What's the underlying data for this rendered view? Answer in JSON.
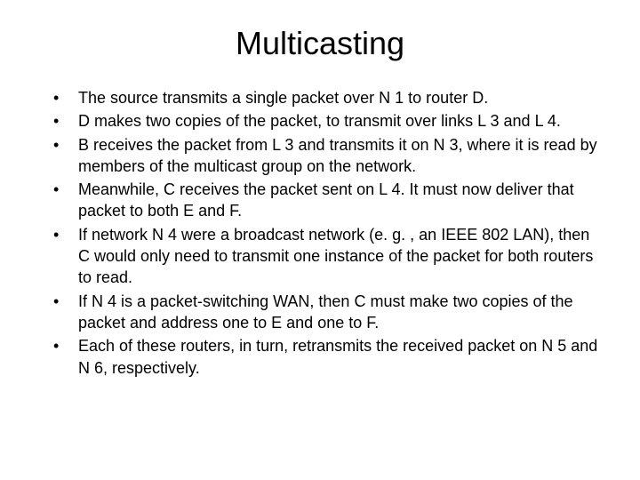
{
  "slide": {
    "title": "Multicasting",
    "bullets": [
      "The source transmits a single packet over N 1 to router D.",
      "D makes two copies of the packet, to transmit over links L 3 and L 4.",
      "B receives the packet from L 3 and transmits it on N 3, where it is read by members of the multicast group on the network.",
      "Meanwhile, C receives the packet sent on L 4. It must now deliver that packet to both E and F.",
      "If network N 4 were a broadcast network (e. g. , an IEEE 802 LAN), then C would only need to transmit one instance of the packet for both routers to read.",
      "If N 4 is a packet-switching WAN, then C must make two copies of the packet and address one to E and one to F.",
      "Each of these routers, in turn, retransmits the received packet on N 5 and N 6, respectively."
    ]
  }
}
